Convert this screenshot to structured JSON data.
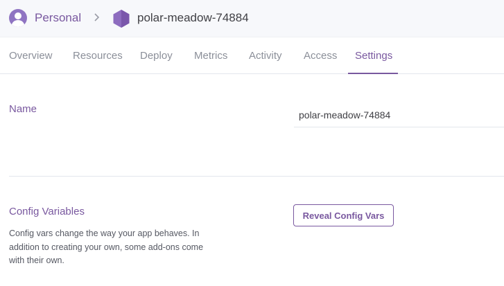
{
  "header": {
    "account_label": "Personal",
    "app_name": "polar-meadow-74884",
    "icons": {
      "avatar": "user-avatar-icon",
      "separator": "chevron-right-icon",
      "app": "hexagon-app-icon"
    }
  },
  "tabs": [
    {
      "label": "Overview"
    },
    {
      "label": "Resources"
    },
    {
      "label": "Deploy"
    },
    {
      "label": "Metrics"
    },
    {
      "label": "Activity"
    },
    {
      "label": "Access"
    },
    {
      "label": "Settings",
      "active": true
    }
  ],
  "settings": {
    "name_label": "Name",
    "name_value": "polar-meadow-74884",
    "config_vars": {
      "title": "Config Variables",
      "description": "Config vars change the way your app behaves. In addition to creating your own, some add-ons come with their own.",
      "button_label": "Reveal Config Vars"
    }
  },
  "colors": {
    "accent": "#79589f",
    "tab_inactive": "#8b8f99",
    "header_bg": "#f7f8fb"
  }
}
